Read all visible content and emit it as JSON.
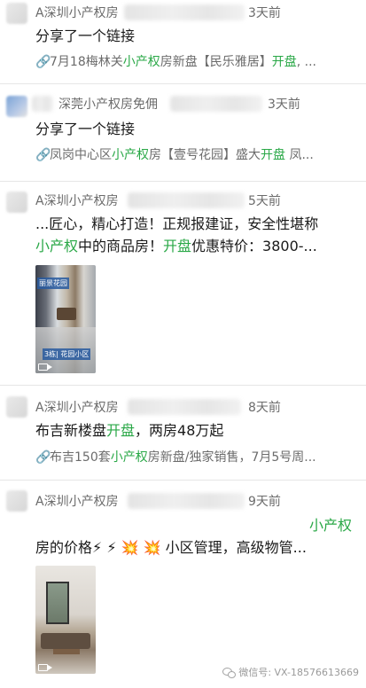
{
  "posts": [
    {
      "author": "A深圳小产权房",
      "time": "3天前",
      "text": "分享了一个链接",
      "link_parts": [
        "7月18梅林关",
        "小产权",
        "房新盘【民乐雅居】",
        "开盘",
        ", ..."
      ]
    },
    {
      "author": "深莞小产权房免佣",
      "time": "3天前",
      "text": "分享了一个链接",
      "link_parts": [
        "凤岗中心区",
        "小产权",
        "房【壹号花园】盛大",
        "开盘",
        " 凤..."
      ]
    },
    {
      "author": "A深圳小产权房",
      "time": "5天前",
      "text_line1": "...匠心，精心打造！正规报建证，安全性堪称",
      "text_line2_parts": [
        "小产权",
        "中的商品房！",
        "开盘",
        "优惠特价：3800-..."
      ],
      "image_tag_top": "丽景花园",
      "image_tag_bottom": "3栋| 花园小区"
    },
    {
      "author": "A深圳小产权房",
      "time": "8天前",
      "text_parts": [
        "布吉新楼盘",
        "开盘",
        "，两房48万起"
      ],
      "link_parts": [
        "布吉150套",
        "小产权",
        "房新盘/独家销售，7月5号周..."
      ]
    },
    {
      "author": "A深圳小产权房",
      "time": "9天前",
      "keyword": "小产权",
      "text_line2": "房的价格⚡ ⚡ 💥 💥 小区管理，高级物管..."
    }
  ],
  "watermark": "微信号: VX-18576613669",
  "colors": {
    "highlight": "#2aa847",
    "meta": "#6b6b6b"
  },
  "icons": {
    "link": "link-icon",
    "video": "video-icon",
    "wechat": "wechat-icon"
  }
}
